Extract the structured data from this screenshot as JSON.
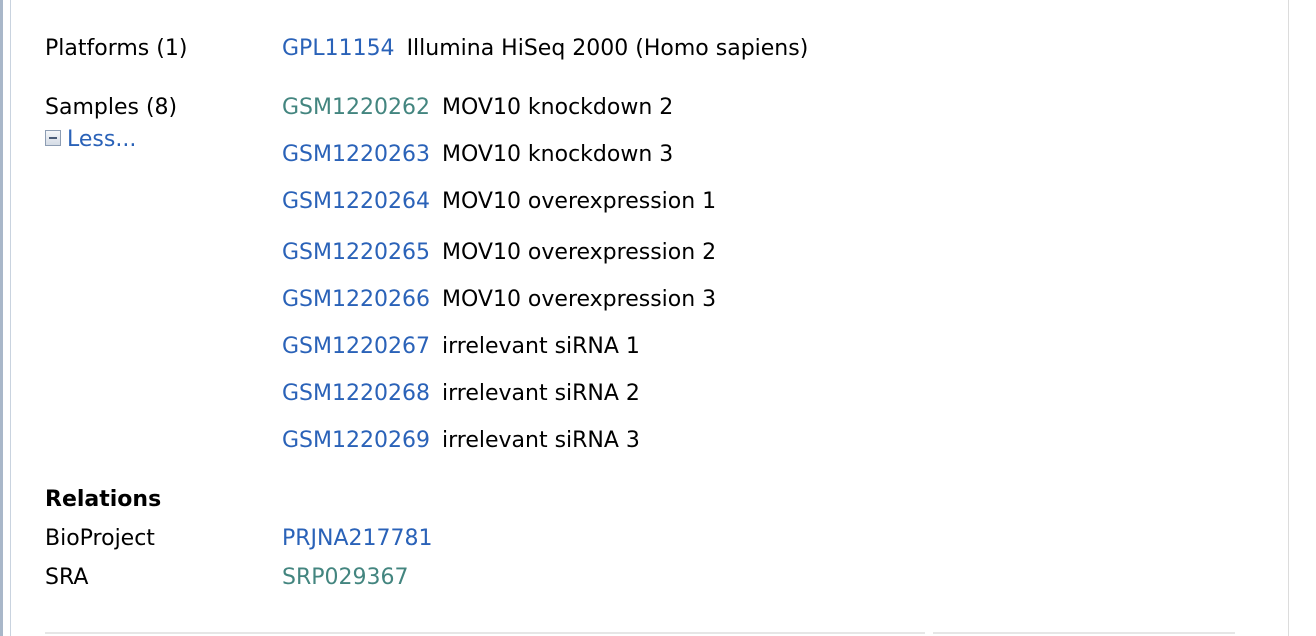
{
  "platforms": {
    "label": "Platforms (1)",
    "items": [
      {
        "accession": "GPL11154",
        "description": "Illumina HiSeq 2000 (Homo sapiens)",
        "visited": false
      }
    ]
  },
  "samples": {
    "label": "Samples (8)",
    "toggle_label": "Less...",
    "toggle_icon": "collapse-minus-icon",
    "items": [
      {
        "accession": "GSM1220262",
        "description": "MOV10 knockdown 2",
        "visited": true
      },
      {
        "accession": "GSM1220263",
        "description": "MOV10 knockdown 3",
        "visited": false
      },
      {
        "accession": "GSM1220264",
        "description": "MOV10 overexpression 1",
        "visited": false
      },
      {
        "accession": "GSM1220265",
        "description": "MOV10 overexpression 2",
        "visited": false
      },
      {
        "accession": "GSM1220266",
        "description": "MOV10 overexpression 3",
        "visited": false
      },
      {
        "accession": "GSM1220267",
        "description": "irrelevant siRNA 1",
        "visited": false
      },
      {
        "accession": "GSM1220268",
        "description": "irrelevant siRNA 2",
        "visited": false
      },
      {
        "accession": "GSM1220269",
        "description": "irrelevant siRNA 3",
        "visited": false
      }
    ]
  },
  "relations": {
    "heading": "Relations",
    "items": [
      {
        "label": "BioProject",
        "value": "PRJNA217781",
        "visited": false
      },
      {
        "label": "SRA",
        "value": "SRP029367",
        "visited": true
      }
    ]
  },
  "colors": {
    "link": "#2a62b8",
    "visited_link": "#43857f",
    "text": "#000000"
  }
}
